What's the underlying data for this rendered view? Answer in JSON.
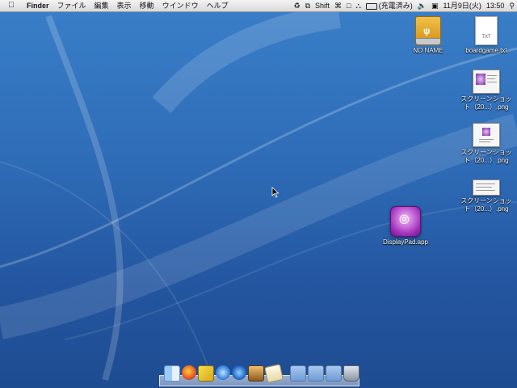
{
  "menubar": {
    "app_name": "Finder",
    "menus": [
      "ファイル",
      "編集",
      "表示",
      "移動",
      "ウインドウ",
      "ヘルプ"
    ],
    "shift_label": "Shift",
    "battery_label": "(充電済み)",
    "date": "11月9日(火)",
    "time": "13:50"
  },
  "desktop": {
    "icons": {
      "drive": "NO NAME",
      "textfile": "boardgame.txt",
      "textfile_badge": "TXT",
      "shot1": "スクリーンショッ\nト（20...）.png",
      "shot2": "スクリーンショッ\nト（20...）.png",
      "shot3": "スクリーンショッ\nト（20...）.png",
      "app": "DisplayPad.app"
    }
  },
  "dock": {
    "items": [
      "finder-icon",
      "firefox-icon",
      "mail-icon",
      "safari-icon",
      "itunes-icon",
      "iphoto-icon",
      "textedit-icon",
      "folder-icon",
      "applications-folder-icon",
      "downloads-folder-icon",
      "trash-icon"
    ]
  },
  "colors": {
    "desktop_top": "#3a7fc9",
    "desktop_bottom": "#1e4c91",
    "drive": "#e0a22a",
    "app_accent": "#a02db8"
  }
}
